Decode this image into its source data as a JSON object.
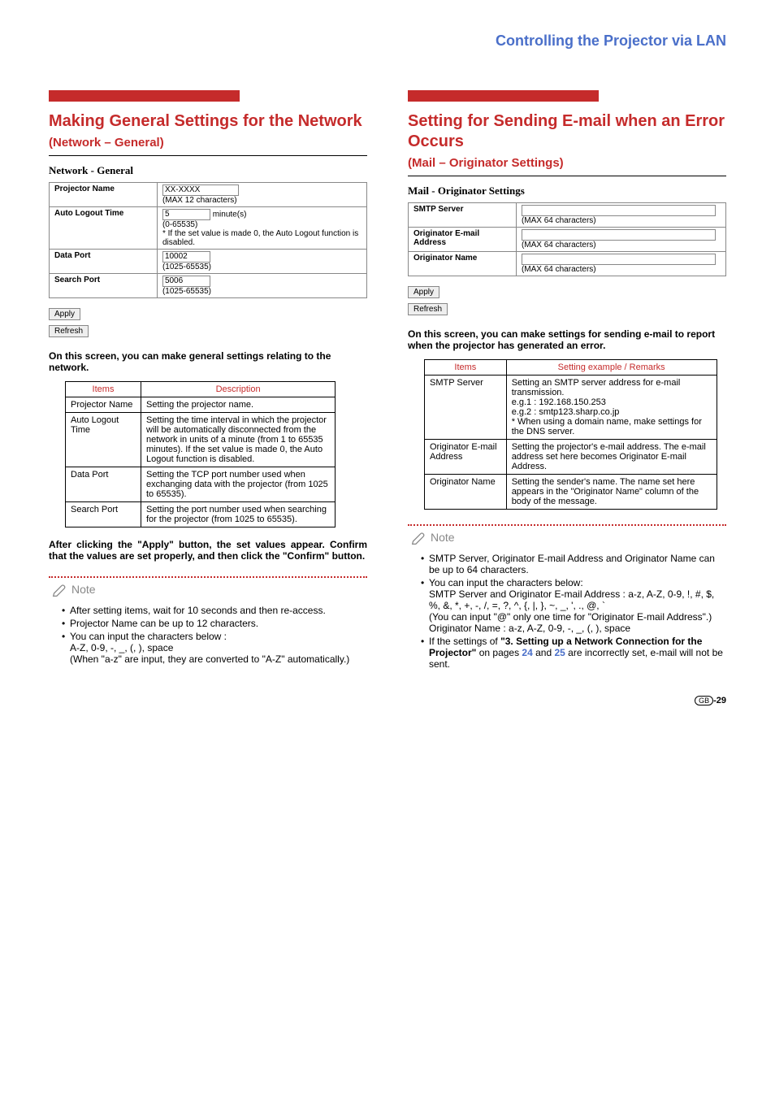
{
  "header": "Controlling the Projector via LAN",
  "left": {
    "title_main": "Making General Settings for the Network ",
    "title_sub": "(Network – General)",
    "subhead": "Network - General",
    "form_rows": [
      {
        "label": "Projector Name",
        "value": "XX-XXXX",
        "note": "(MAX 12 characters)"
      },
      {
        "label": "Auto Logout Time",
        "value": "5",
        "unit": "minute(s)",
        "note": "(0-65535)\n* If the set value is made 0, the Auto Logout function is disabled."
      },
      {
        "label": "Data Port",
        "value": "10002",
        "note": "(1025-65535)"
      },
      {
        "label": "Search Port",
        "value": "5006",
        "note": "(1025-65535)"
      }
    ],
    "apply": "Apply",
    "refresh": "Refresh",
    "lead": "On this screen, you can make general settings relating to the network.",
    "table_h1": "Items",
    "table_h2": "Description",
    "table_rows": [
      {
        "item": "Projector Name",
        "desc": "Setting the projector name."
      },
      {
        "item": "Auto Logout Time",
        "desc": "Setting the time interval in which the projector will be automatically disconnected from the network in units of a minute (from 1 to 65535 minutes). If the set value is made 0, the Auto Logout function is disabled."
      },
      {
        "item": "Data Port",
        "desc": "Setting the TCP port number used when exchanging data with the projector (from 1025 to 65535)."
      },
      {
        "item": "Search Port",
        "desc": "Setting the port number used when searching for the projector (from 1025 to 65535)."
      }
    ],
    "after": "After clicking the \"Apply\" button, the set values appear. Confirm that the values are set properly, and then click the \"Confirm\" button.",
    "note_label": "Note",
    "notes": [
      "After setting items, wait for 10 seconds and then re-access.",
      "Projector Name can be up to 12 characters.",
      "You can input the characters below :\nA-Z, 0-9, -, _, (, ), space\n(When \"a-z\" are input, they are converted to \"A-Z\" automatically.)"
    ]
  },
  "right": {
    "title_main1": "Setting for Sending E-mail when an Error Occurs",
    "title_sub": "(Mail – Originator Settings)",
    "subhead": "Mail - Originator Settings",
    "form_rows": [
      {
        "label": "SMTP Server",
        "note": "(MAX 64 characters)"
      },
      {
        "label": "Originator E-mail Address",
        "note": "(MAX 64 characters)"
      },
      {
        "label": "Originator Name",
        "note": "(MAX 64 characters)"
      }
    ],
    "apply": "Apply",
    "refresh": "Refresh",
    "lead": "On this screen, you can make settings for sending e-mail to report when the projector has generated an error.",
    "table_h1": "Items",
    "table_h2": "Setting example / Remarks",
    "table_rows": [
      {
        "item": "SMTP Server",
        "desc": "Setting an SMTP server address for e-mail transmission.\ne.g.1 : 192.168.150.253\ne.g.2 : smtp123.sharp.co.jp\n* When using a domain name, make settings for the DNS server."
      },
      {
        "item": "Originator E-mail Address",
        "desc": "Setting the projector's e-mail address. The e-mail address set here becomes Originator E-mail Address."
      },
      {
        "item": "Originator Name",
        "desc": "Setting the sender's name. The name set here appears in the \"Originator Name\" column of the body of the message."
      }
    ],
    "note_label": "Note",
    "notes": [
      "SMTP Server, Originator E-mail Address and Originator Name can be up to 64 characters.",
      "You can input the characters below:\nSMTP Server and Originator E-mail Address : a-z, A-Z, 0-9, !, #, $, %, &, *, +, -, /, =, ?, ^, {, |, }, ~, _, ', ., @, `\n(You can input \"@\" only one time for \"Originator E-mail Address\".)\nOriginator Name : a-z, A-Z, 0-9, -, _, (, ), space"
    ],
    "note3_pre": "If the settings of ",
    "note3_bold": "\"3. Setting up a Network Connection for the Projector\"",
    "note3_mid": " on pages ",
    "note3_p1": "24",
    "note3_and": " and ",
    "note3_p2": "25",
    "note3_post": " are incorrectly set, e-mail will not be sent."
  },
  "page_gb": "GB",
  "page_num": "-29"
}
